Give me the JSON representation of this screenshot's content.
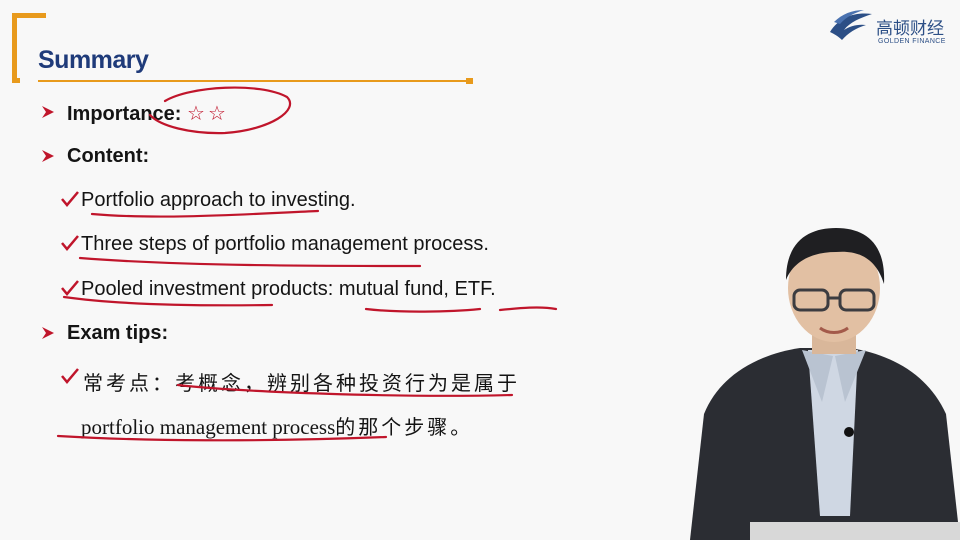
{
  "slide": {
    "title": "Summary",
    "logo": {
      "cn": "高顿财经",
      "en": "GOLDEN FINANCE"
    },
    "importance": {
      "label": "Importance:",
      "stars": "☆☆"
    },
    "content": {
      "label": "Content:",
      "items": [
        "Portfolio approach to investing.",
        "Three steps of portfolio management process.",
        "Pooled investment products: mutual fund, ETF."
      ]
    },
    "exam_tips": {
      "label": "Exam tips:",
      "line1": "常考点：考概念，辨别各种投资行为是属于",
      "line2_latin": "portfolio management process",
      "line2_cn": "的那个步骤。"
    }
  },
  "colors": {
    "accent": "#e89a1c",
    "title": "#1f3b7a",
    "annotation": "#c0152b"
  }
}
